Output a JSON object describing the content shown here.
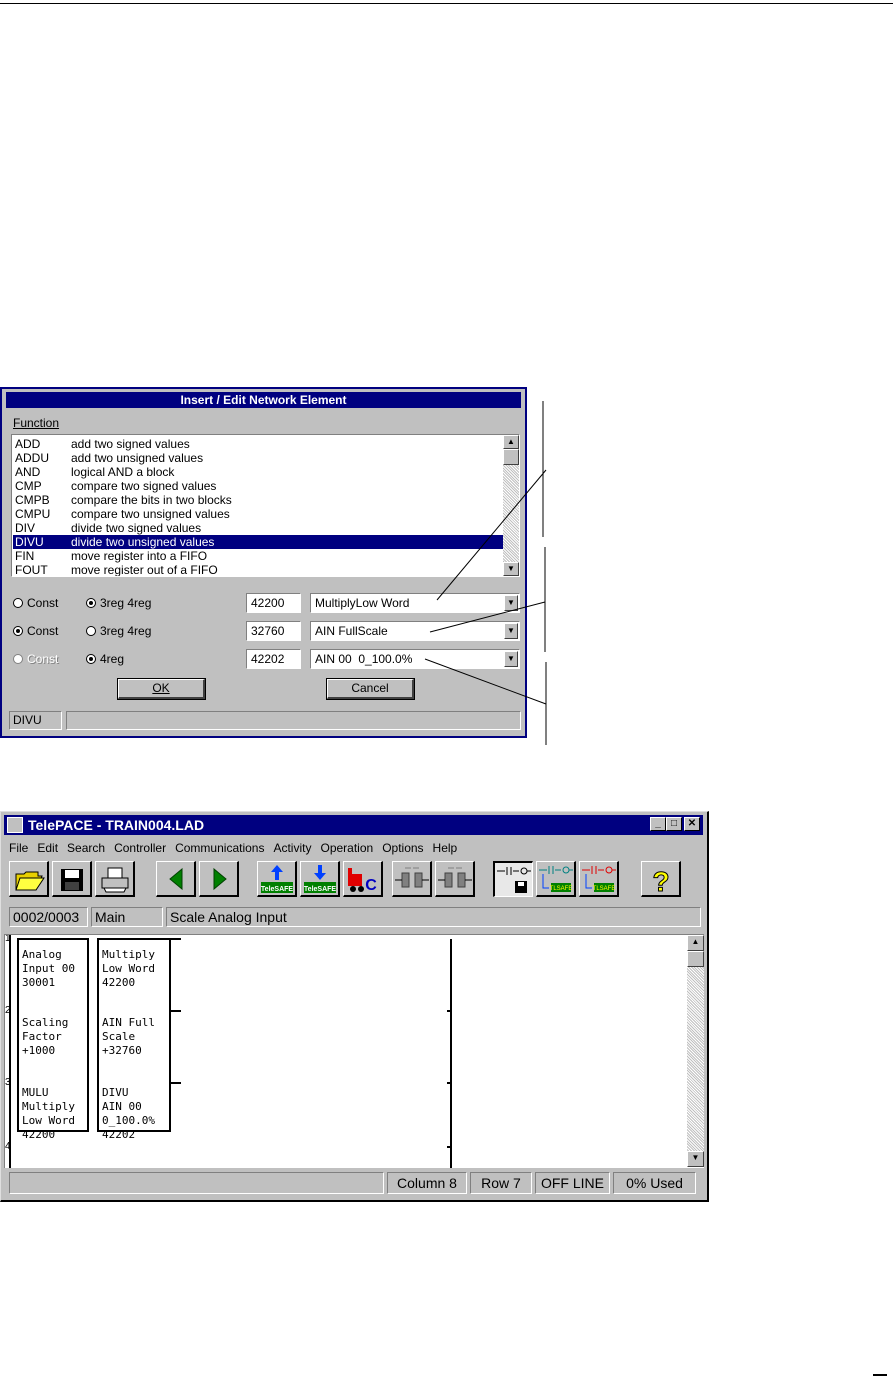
{
  "dialog": {
    "title": "Insert / Edit Network Element",
    "function_label": "Function",
    "functions": [
      {
        "code": "ADD",
        "desc": "add two signed values"
      },
      {
        "code": "ADDU",
        "desc": "add two unsigned values"
      },
      {
        "code": "AND",
        "desc": "logical AND a block"
      },
      {
        "code": "CMP",
        "desc": "compare two signed values"
      },
      {
        "code": "CMPB",
        "desc": "compare the bits in two blocks"
      },
      {
        "code": "CMPU",
        "desc": "compare two unsigned values"
      },
      {
        "code": "DIV",
        "desc": "divide two signed values"
      },
      {
        "code": "DIVU",
        "desc": "divide two unsigned values"
      },
      {
        "code": "FIN",
        "desc": "move register into a FIFO"
      },
      {
        "code": "FOUT",
        "desc": "move register out of a FIFO"
      }
    ],
    "selected_function": "DIVU",
    "operands": [
      {
        "opt1": "Const",
        "opt2": "3reg 4reg",
        "selected": "opt2",
        "address": "42200",
        "tag": "MultiplyLow Word"
      },
      {
        "opt1": "Const",
        "opt2": "3reg 4reg",
        "selected": "opt1",
        "address": "32760",
        "tag": "AIN FullScale"
      },
      {
        "opt1": "Const",
        "opt2": "4reg",
        "selected": "opt2",
        "address": "42202",
        "tag": "AIN 00  0_100.0%"
      }
    ],
    "ok_label": "OK",
    "cancel_label": "Cancel",
    "status_text": "DIVU"
  },
  "telepace": {
    "title": "TelePACE - TRAIN004.LAD",
    "menu": [
      "File",
      "Edit",
      "Search",
      "Controller",
      "Communications",
      "Activity",
      "Operation",
      "Options",
      "Help"
    ],
    "toolbar_labels": {
      "telesafe": "TeleSAFE",
      "tlsafe": "TLSAFE",
      "c": "C"
    },
    "network_position": "0002/0003",
    "program_name": "Main",
    "network_title": "Scale Analog Input",
    "row_numbers": [
      "1",
      "2",
      "3",
      "4"
    ],
    "column1_cells": [
      "Analog\nInput 00\n30001",
      "Scaling\nFactor\n+1000",
      "MULU\nMultiply\nLow Word\n42200"
    ],
    "column2_cells": [
      "Multiply\nLow Word\n42200",
      "AIN Full\nScale\n+32760",
      "DIVU\nAIN 00\n0_100.0%\n42202"
    ],
    "status": {
      "column": "Column 8",
      "row": "Row 7",
      "mode": "OFF LINE",
      "used": "0% Used"
    }
  }
}
